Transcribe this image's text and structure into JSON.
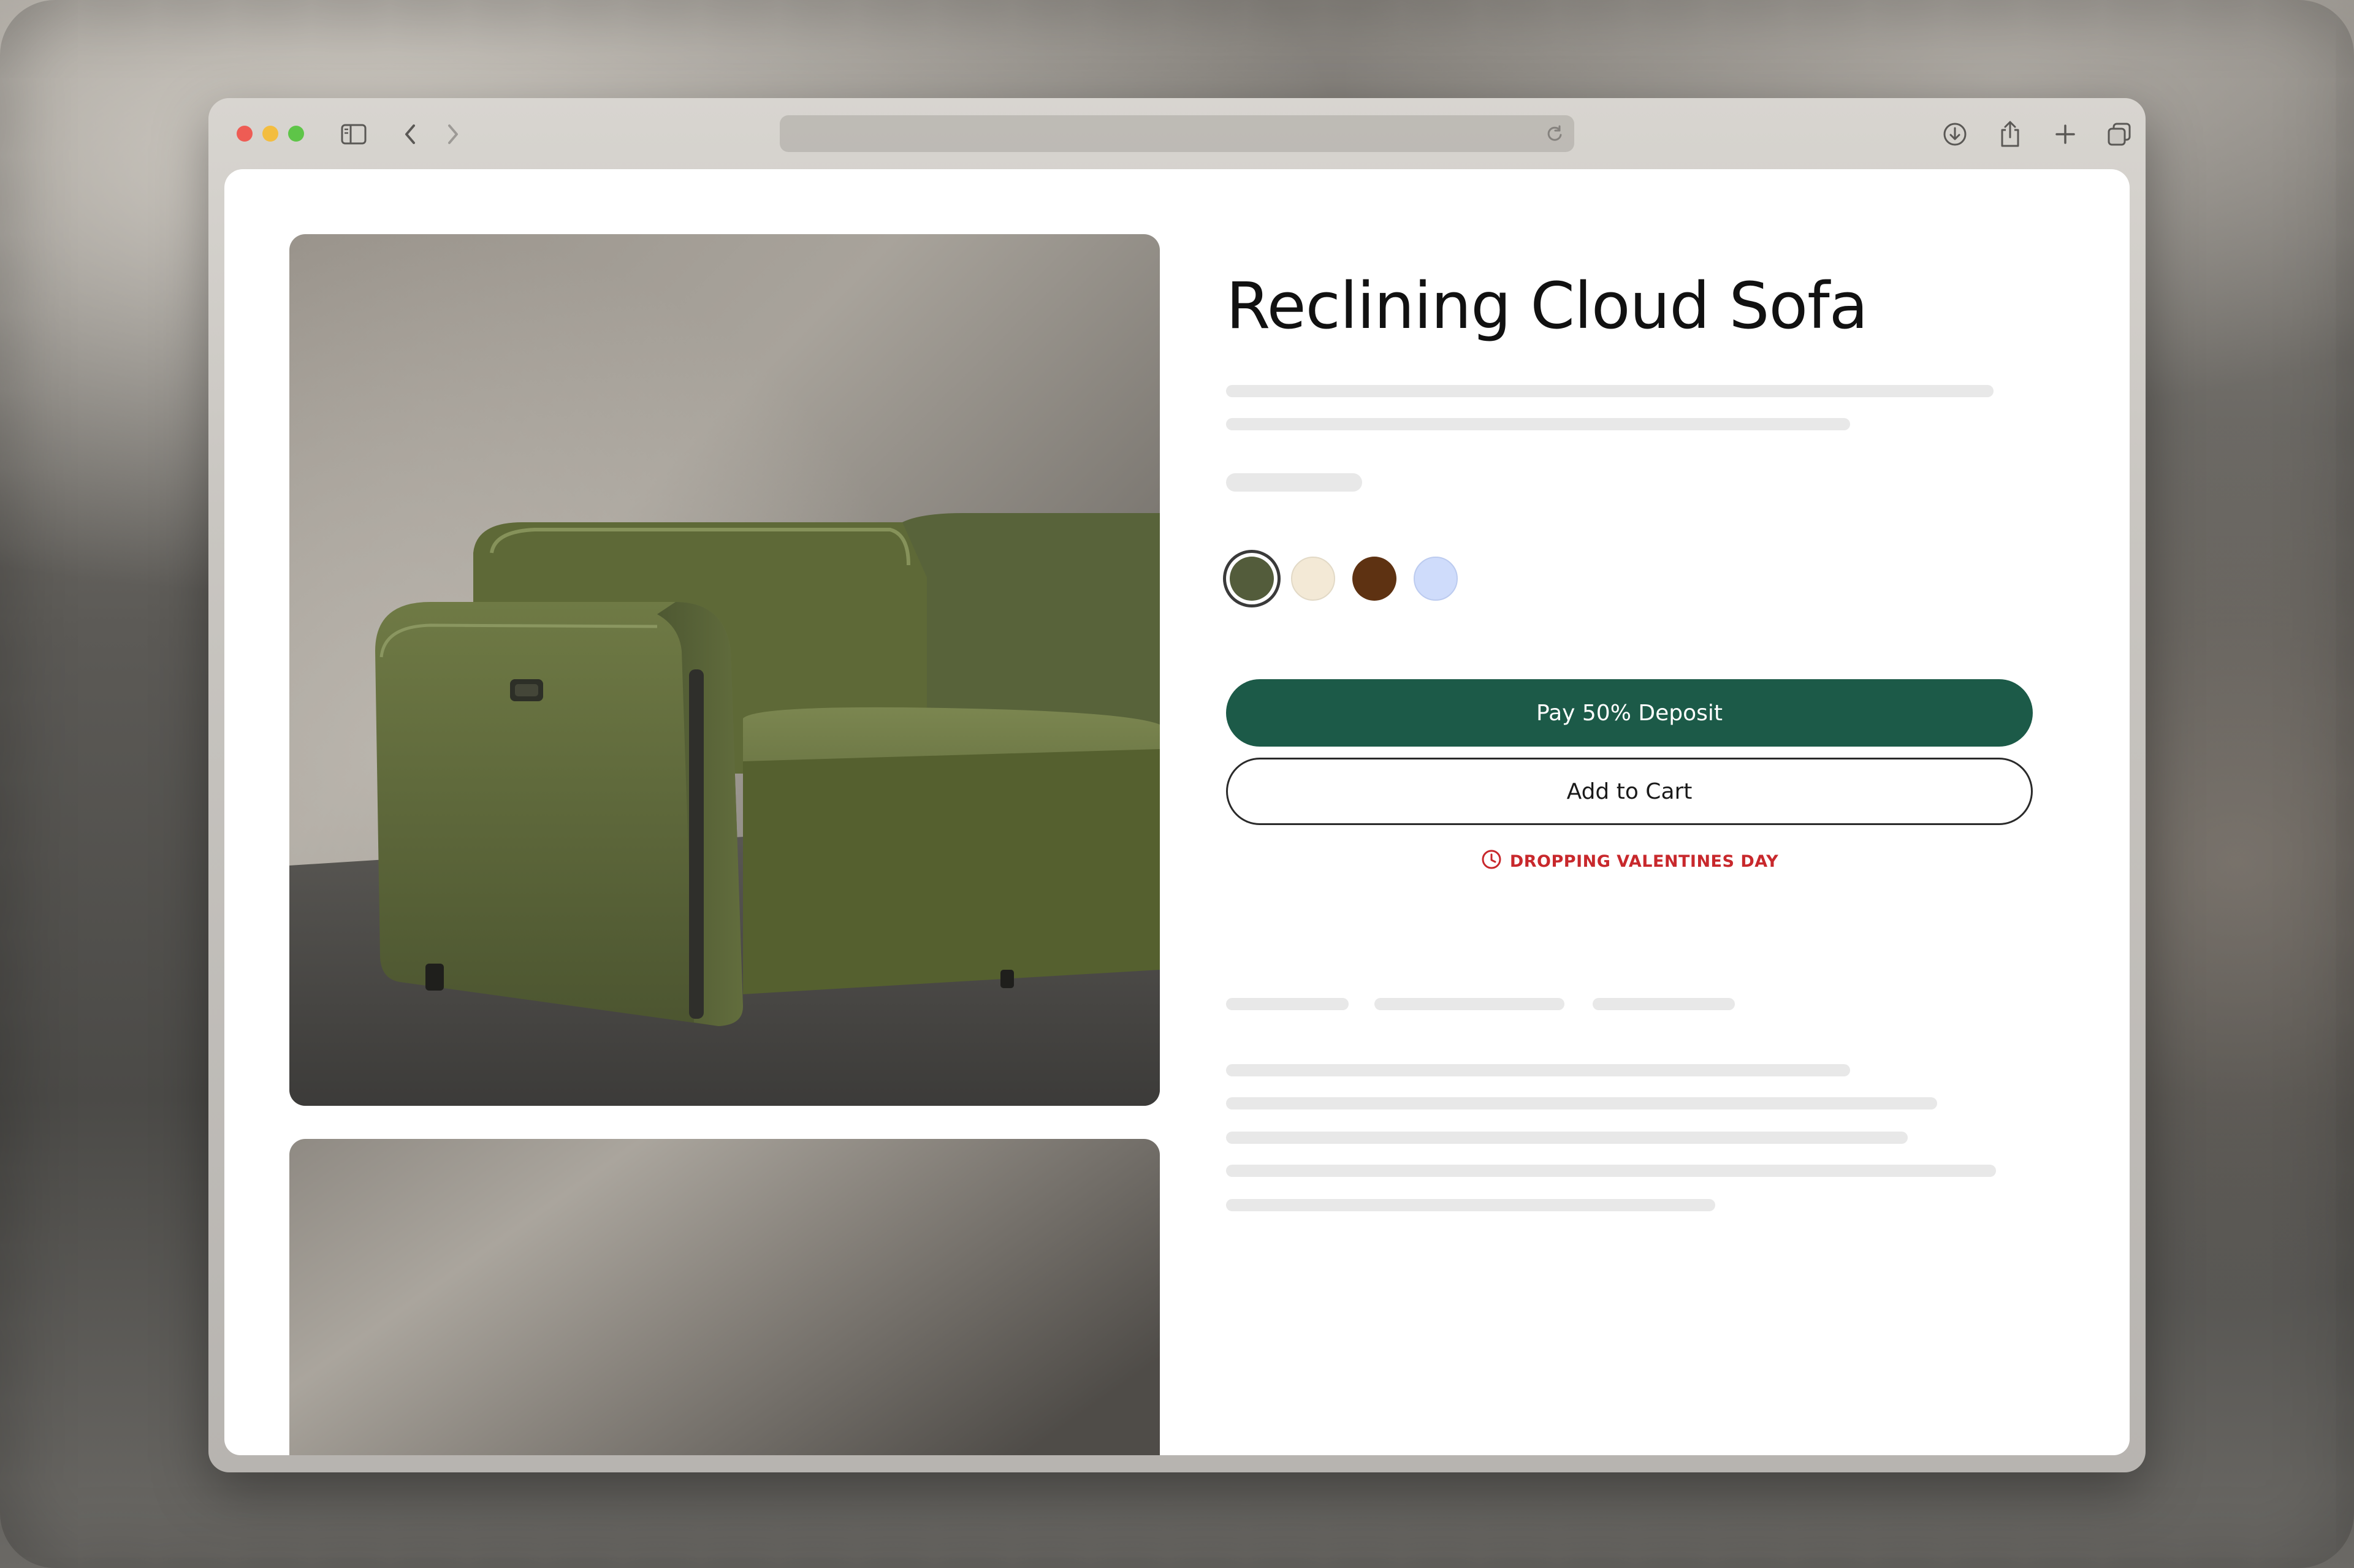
{
  "product": {
    "title": "Reclining Cloud Sofa",
    "swatches": [
      {
        "name": "olive",
        "color": "#535c3b",
        "selected": true
      },
      {
        "name": "cream",
        "color": "#f3e9d6",
        "selected": false
      },
      {
        "name": "brown",
        "color": "#5e3212",
        "selected": false
      },
      {
        "name": "periwinkle",
        "color": "#cfdcfb",
        "selected": false
      }
    ],
    "primary_button_label": "Pay 50% Deposit",
    "secondary_button_label": "Add to Cart",
    "drop_notice": "DROPPING VALENTINES DAY"
  },
  "colors": {
    "primary_button": "#1c5a48",
    "notice": "#c8282c",
    "skeleton": "#e8e8e8"
  },
  "toolbar": {
    "icons": [
      "sidebar-icon",
      "back-icon",
      "forward-icon",
      "reload-icon",
      "download-icon",
      "share-icon",
      "new-tab-icon",
      "tabs-overview-icon"
    ]
  }
}
